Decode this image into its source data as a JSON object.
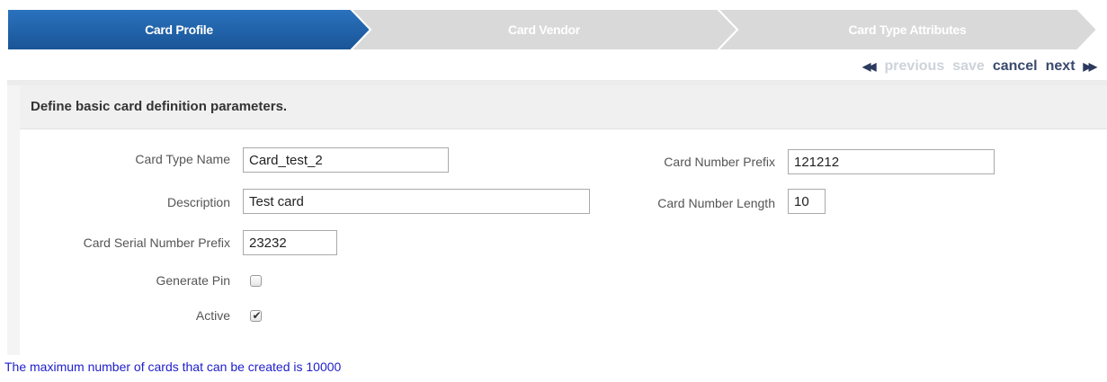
{
  "wizard": {
    "steps": [
      {
        "label": "Card Profile",
        "state": "active"
      },
      {
        "label": "Card Vendor",
        "state": "inactive"
      },
      {
        "label": "Card Type Attributes",
        "state": "inactive"
      }
    ],
    "colors": {
      "active": "#1f62a7",
      "inactive": "#d9d9d9"
    }
  },
  "nav": {
    "previous": "previous",
    "save": "save",
    "cancel": "cancel",
    "next": "next",
    "previous_icon": "double-left-arrow-icon",
    "next_icon": "double-right-arrow-icon",
    "previous_glyph": "◀◀",
    "next_glyph": "▶▶"
  },
  "section": {
    "title": "Define basic card definition parameters."
  },
  "form": {
    "card_type_name": {
      "label": "Card Type Name",
      "value": "Card_test_2"
    },
    "description": {
      "label": "Description",
      "value": "Test card"
    },
    "card_serial_number_prefix": {
      "label": "Card Serial Number Prefix",
      "value": "23232"
    },
    "generate_pin": {
      "label": "Generate Pin",
      "checked": false
    },
    "active": {
      "label": "Active",
      "checked": true,
      "tick_glyph": "✔"
    },
    "card_number_prefix": {
      "label": "Card Number Prefix",
      "value": "121212"
    },
    "card_number_length": {
      "label": "Card Number Length",
      "value": "10"
    }
  },
  "message": "The maximum number of cards that can be created is 10000",
  "colors": {
    "message": "#2020cc",
    "nav_enabled": "#3a4a6e",
    "nav_disabled": "#cdd3da"
  }
}
